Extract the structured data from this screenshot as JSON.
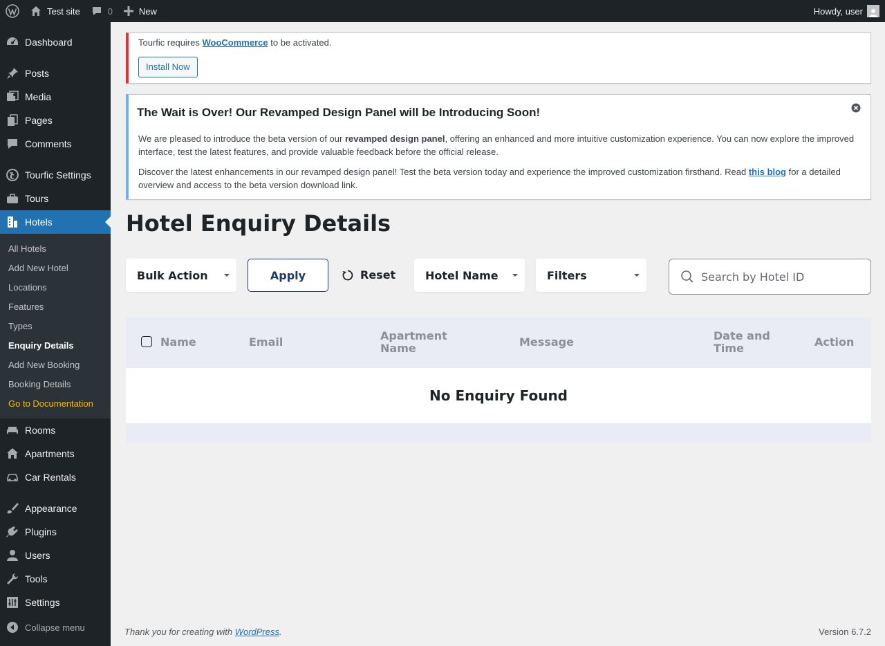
{
  "adminbar": {
    "site_name": "Test site",
    "comments_count": "0",
    "new_label": "New",
    "greeting": "Howdy, user"
  },
  "sidebar": {
    "items": [
      {
        "label": "Dashboard",
        "icon": "dashboard-icon"
      },
      {
        "label": "Posts",
        "icon": "pin-icon"
      },
      {
        "label": "Media",
        "icon": "media-icon"
      },
      {
        "label": "Pages",
        "icon": "pages-icon"
      },
      {
        "label": "Comments",
        "icon": "comment-icon"
      },
      {
        "label": "Tourfic Settings",
        "icon": "tourfic-icon"
      },
      {
        "label": "Tours",
        "icon": "tours-icon"
      },
      {
        "label": "Hotels",
        "icon": "hotel-icon"
      },
      {
        "label": "Rooms",
        "icon": "bed-icon"
      },
      {
        "label": "Apartments",
        "icon": "home-icon"
      },
      {
        "label": "Car Rentals",
        "icon": "car-icon"
      },
      {
        "label": "Appearance",
        "icon": "brush-icon"
      },
      {
        "label": "Plugins",
        "icon": "plugin-icon"
      },
      {
        "label": "Users",
        "icon": "user-icon"
      },
      {
        "label": "Tools",
        "icon": "wrench-icon"
      },
      {
        "label": "Settings",
        "icon": "settings-icon"
      }
    ],
    "submenu": [
      "All Hotels",
      "Add New Hotel",
      "Locations",
      "Features",
      "Types",
      "Enquiry Details",
      "Add New Booking",
      "Booking Details",
      "Go to Documentation"
    ],
    "collapse_label": "Collapse menu"
  },
  "notices": {
    "error_prefix": "Tourfic requires",
    "error_link": "WooCommerce",
    "error_suffix": "to be activated.",
    "install_button": "Install Now",
    "info_title": "The Wait is Over! Our Revamped Design Panel will be Introducing Soon!",
    "info_p1_a": "We are pleased to introduce the beta version of our",
    "info_p1_bold": "revamped design panel",
    "info_p1_b": ", offering an enhanced and more intuitive customization experience. You can now explore the improved interface, test the latest features, and provide valuable feedback before the official release.",
    "info_p2_a": "Discover the latest enhancements in our revamped design panel! Test the beta version today and experience the improved customization firsthand. Read",
    "info_p2_link": "this blog",
    "info_p2_b": "for a detailed overview and access to the beta version download link."
  },
  "page": {
    "title": "Hotel Enquiry Details",
    "bulk_action": "Bulk Action",
    "apply": "Apply",
    "reset": "Reset",
    "hotel_name": "Hotel Name",
    "filters": "Filters",
    "search_placeholder": "Search by Hotel ID"
  },
  "table": {
    "columns": [
      "Name",
      "Email",
      "Apartment Name",
      "Message",
      "Date and Time",
      "Action"
    ],
    "empty_text": "No Enquiry Found"
  },
  "footer": {
    "thanks_prefix": "Thank you for creating with",
    "thanks_link": "WordPress",
    "version": "Version 6.7.2"
  },
  "colors": {
    "admin_bg": "#1d2327",
    "accent": "#2271b1",
    "error": "#d63638",
    "info": "#72aee6",
    "doc_link": "#ffba00"
  }
}
